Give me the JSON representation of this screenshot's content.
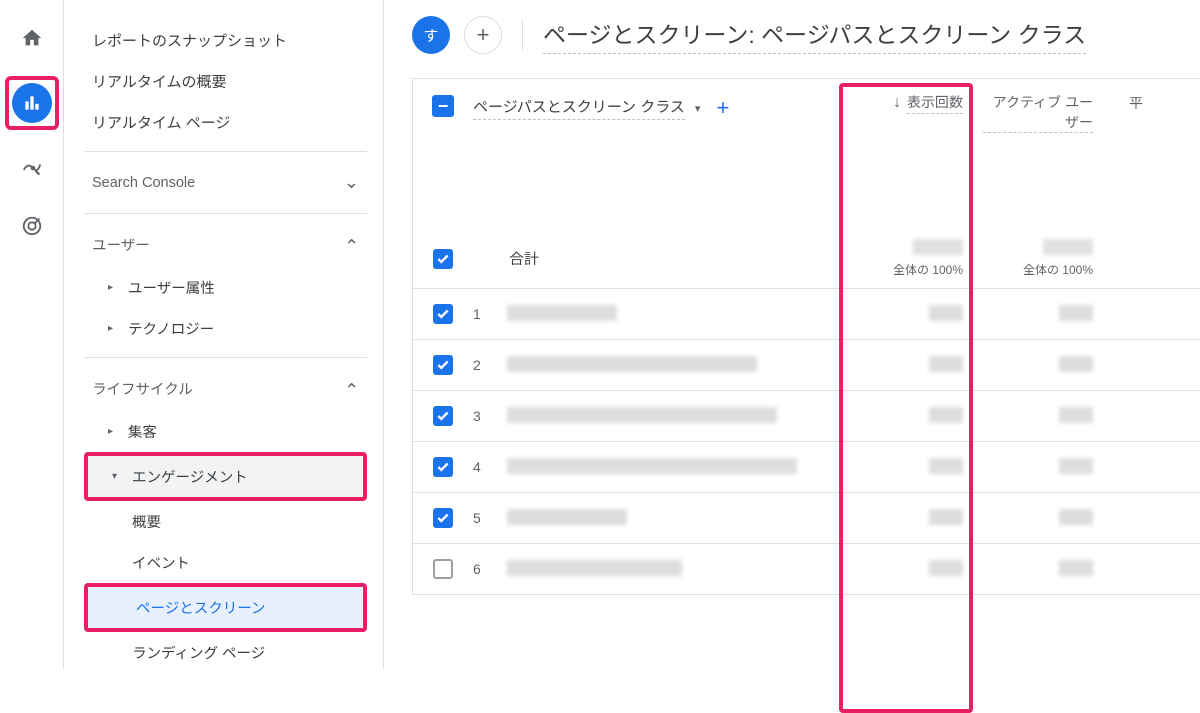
{
  "rail": {
    "items": [
      "home",
      "reports",
      "explore",
      "advertising"
    ]
  },
  "sidebar": {
    "snapshot": "レポートのスナップショット",
    "realtime_overview": "リアルタイムの概要",
    "realtime_page": "リアルタイム ページ",
    "search_console": "Search Console",
    "user_section": "ユーザー",
    "user_attr": "ユーザー属性",
    "tech": "テクノロジー",
    "lifecycle": "ライフサイクル",
    "acquisition": "集客",
    "engagement": "エンゲージメント",
    "overview": "概要",
    "events": "イベント",
    "pages_screens": "ページとスクリーン",
    "landing": "ランディング ページ"
  },
  "header": {
    "chip_label": "す",
    "title": "ページとスクリーン: ページパスとスクリーン クラス"
  },
  "table": {
    "dimension_label": "ページパスとスクリーン クラス",
    "m1": "表示回数",
    "m2": "アクティブ ユーザー",
    "m3_partial": "平",
    "total_label": "合計",
    "total_pct": "全体の 100%",
    "rows": [
      {
        "n": "1",
        "checked": true,
        "bar": 110
      },
      {
        "n": "2",
        "checked": true,
        "bar": 250
      },
      {
        "n": "3",
        "checked": true,
        "bar": 270
      },
      {
        "n": "4",
        "checked": true,
        "bar": 290
      },
      {
        "n": "5",
        "checked": true,
        "bar": 120
      },
      {
        "n": "6",
        "checked": false,
        "bar": 175
      }
    ]
  }
}
